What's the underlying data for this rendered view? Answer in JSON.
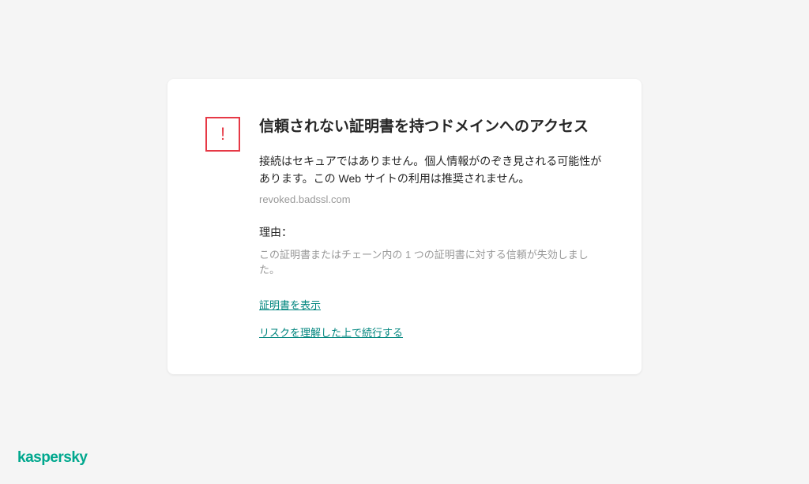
{
  "warning": {
    "title": "信頼されない証明書を持つドメインへのアクセス",
    "description": "接続はセキュアではありません。個人情報がのぞき見される可能性があります。この Web サイトの利用は推奨されません。",
    "domain": "revoked.badssl.com",
    "reason_label": "理由：",
    "reason_text": "この証明書またはチェーン内の 1 つの証明書に対する信頼が失効しました。",
    "show_certificate_link": "証明書を表示",
    "continue_link": "リスクを理解した上で続行する"
  },
  "brand": "kaspersky"
}
